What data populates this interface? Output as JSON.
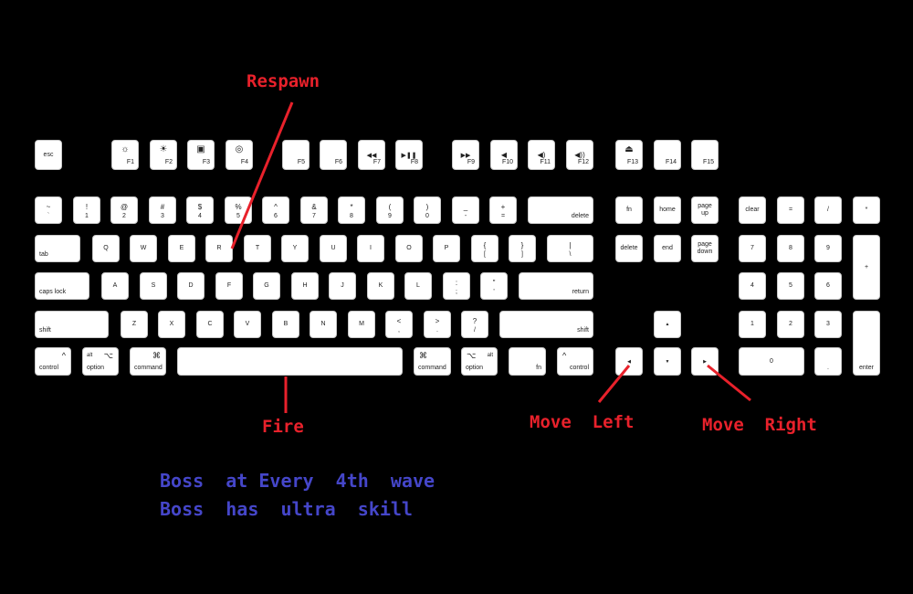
{
  "annotations": {
    "respawn": "Respawn",
    "fire": "Fire",
    "move_left": "Move  Left",
    "move_right": "Move  Right",
    "notes": [
      "Boss  at Every  4th  wave",
      "Boss  has  ultra  skill"
    ]
  },
  "colors": {
    "annotation_red": "#e8212b",
    "note_blue": "#4546c9",
    "key_fill": "#ffffff",
    "background": "#000000"
  },
  "keys": {
    "fn_row": [
      {
        "id": "esc",
        "label": "esc"
      },
      {
        "id": "f1",
        "label": "F1",
        "icon": "brightness-down-icon",
        "glyph": "☼"
      },
      {
        "id": "f2",
        "label": "F2",
        "icon": "brightness-up-icon",
        "glyph": "☀"
      },
      {
        "id": "f3",
        "label": "F3",
        "icon": "mission-control-icon",
        "glyph": "▣"
      },
      {
        "id": "f4",
        "label": "F4",
        "icon": "dashboard-icon",
        "glyph": "◎"
      },
      {
        "id": "f5",
        "label": "F5"
      },
      {
        "id": "f6",
        "label": "F6"
      },
      {
        "id": "f7",
        "label": "F7",
        "icon": "rewind-icon",
        "glyph": "◀◀"
      },
      {
        "id": "f8",
        "label": "F8",
        "icon": "play-pause-icon",
        "glyph": "▶❚❚"
      },
      {
        "id": "f9",
        "label": "F9",
        "icon": "fast-forward-icon",
        "glyph": "▶▶"
      },
      {
        "id": "f10",
        "label": "F10",
        "icon": "mute-icon",
        "glyph": "◀"
      },
      {
        "id": "f11",
        "label": "F11",
        "icon": "volume-down-icon",
        "glyph": "◀)"
      },
      {
        "id": "f12",
        "label": "F12",
        "icon": "volume-up-icon",
        "glyph": "◀))"
      },
      {
        "id": "f13",
        "label": "F13",
        "icon": "eject-icon",
        "glyph": "⏏"
      },
      {
        "id": "f14",
        "label": "F14"
      },
      {
        "id": "f15",
        "label": "F15"
      }
    ],
    "number_row": [
      {
        "id": "backtick",
        "top": "~",
        "bottom": "`"
      },
      {
        "id": "1",
        "top": "!",
        "bottom": "1"
      },
      {
        "id": "2",
        "top": "@",
        "bottom": "2"
      },
      {
        "id": "3",
        "top": "#",
        "bottom": "3"
      },
      {
        "id": "4",
        "top": "$",
        "bottom": "4"
      },
      {
        "id": "5",
        "top": "%",
        "bottom": "5"
      },
      {
        "id": "6",
        "top": "^",
        "bottom": "6"
      },
      {
        "id": "7",
        "top": "&",
        "bottom": "7"
      },
      {
        "id": "8",
        "top": "*",
        "bottom": "8"
      },
      {
        "id": "9",
        "top": "(",
        "bottom": "9"
      },
      {
        "id": "0",
        "top": ")",
        "bottom": "0"
      },
      {
        "id": "minus",
        "top": "_",
        "bottom": "-"
      },
      {
        "id": "equals",
        "top": "+",
        "bottom": "="
      },
      {
        "id": "delete",
        "label": "delete"
      }
    ],
    "tab_row": [
      "tab",
      "Q",
      "W",
      "E",
      "R",
      "T",
      "Y",
      "U",
      "I",
      "O",
      "P"
    ],
    "tab_row_brackets": [
      {
        "id": "lbracket",
        "top": "{",
        "bottom": "["
      },
      {
        "id": "rbracket",
        "top": "}",
        "bottom": "]"
      },
      {
        "id": "backslash",
        "top": "|",
        "bottom": "\\"
      }
    ],
    "caps_row": [
      "caps lock",
      "A",
      "S",
      "D",
      "F",
      "G",
      "H",
      "J",
      "K",
      "L"
    ],
    "caps_row_punct": [
      {
        "id": "semicolon",
        "top": ":",
        "bottom": ";"
      },
      {
        "id": "quote",
        "top": "\"",
        "bottom": "'"
      },
      {
        "id": "return",
        "label": "return"
      }
    ],
    "shift_row": [
      "shift",
      "Z",
      "X",
      "C",
      "V",
      "B",
      "N",
      "M"
    ],
    "shift_row_punct": [
      {
        "id": "comma",
        "top": "<",
        "bottom": ","
      },
      {
        "id": "period",
        "top": ">",
        "bottom": "."
      },
      {
        "id": "slash",
        "top": "?",
        "bottom": "/"
      },
      {
        "id": "rshift",
        "label": "shift"
      }
    ],
    "bottom_row": [
      {
        "id": "lcontrol",
        "label": "control",
        "sym": "^"
      },
      {
        "id": "loption",
        "label": "option",
        "sym": "⌥",
        "alt": "alt"
      },
      {
        "id": "lcommand",
        "label": "command",
        "sym": "⌘"
      },
      {
        "id": "space",
        "label": ""
      },
      {
        "id": "rcommand",
        "label": "command",
        "sym": "⌘"
      },
      {
        "id": "roption",
        "label": "option",
        "sym": "⌥",
        "alt": "alt"
      },
      {
        "id": "fn",
        "label": "fn"
      },
      {
        "id": "rcontrol",
        "label": "control",
        "sym": "^"
      }
    ],
    "nav_cluster": [
      {
        "id": "fn2",
        "label": "fn"
      },
      {
        "id": "home",
        "label": "home"
      },
      {
        "id": "pageup",
        "label": "page\nup"
      },
      {
        "id": "fwd_delete",
        "label": "delete"
      },
      {
        "id": "end",
        "label": "end"
      },
      {
        "id": "pagedown",
        "label": "page\ndown"
      }
    ],
    "arrows": {
      "up": "▲",
      "left": "◀",
      "down": "▼",
      "right": "▶"
    },
    "numpad": [
      {
        "id": "clear",
        "label": "clear"
      },
      {
        "id": "np_eq",
        "label": "="
      },
      {
        "id": "np_div",
        "label": "/"
      },
      {
        "id": "np_mul",
        "label": "*"
      },
      {
        "id": "np_minus",
        "label": "–"
      },
      {
        "id": "np7",
        "label": "7"
      },
      {
        "id": "np8",
        "label": "8"
      },
      {
        "id": "np9",
        "label": "9"
      },
      {
        "id": "np_plus",
        "label": "+"
      },
      {
        "id": "np4",
        "label": "4"
      },
      {
        "id": "np5",
        "label": "5"
      },
      {
        "id": "np6",
        "label": "6"
      },
      {
        "id": "np1",
        "label": "1"
      },
      {
        "id": "np2",
        "label": "2"
      },
      {
        "id": "np3",
        "label": "3"
      },
      {
        "id": "np_enter",
        "label": "enter"
      },
      {
        "id": "np0",
        "label": "0"
      },
      {
        "id": "np_dot",
        "label": "."
      }
    ]
  }
}
